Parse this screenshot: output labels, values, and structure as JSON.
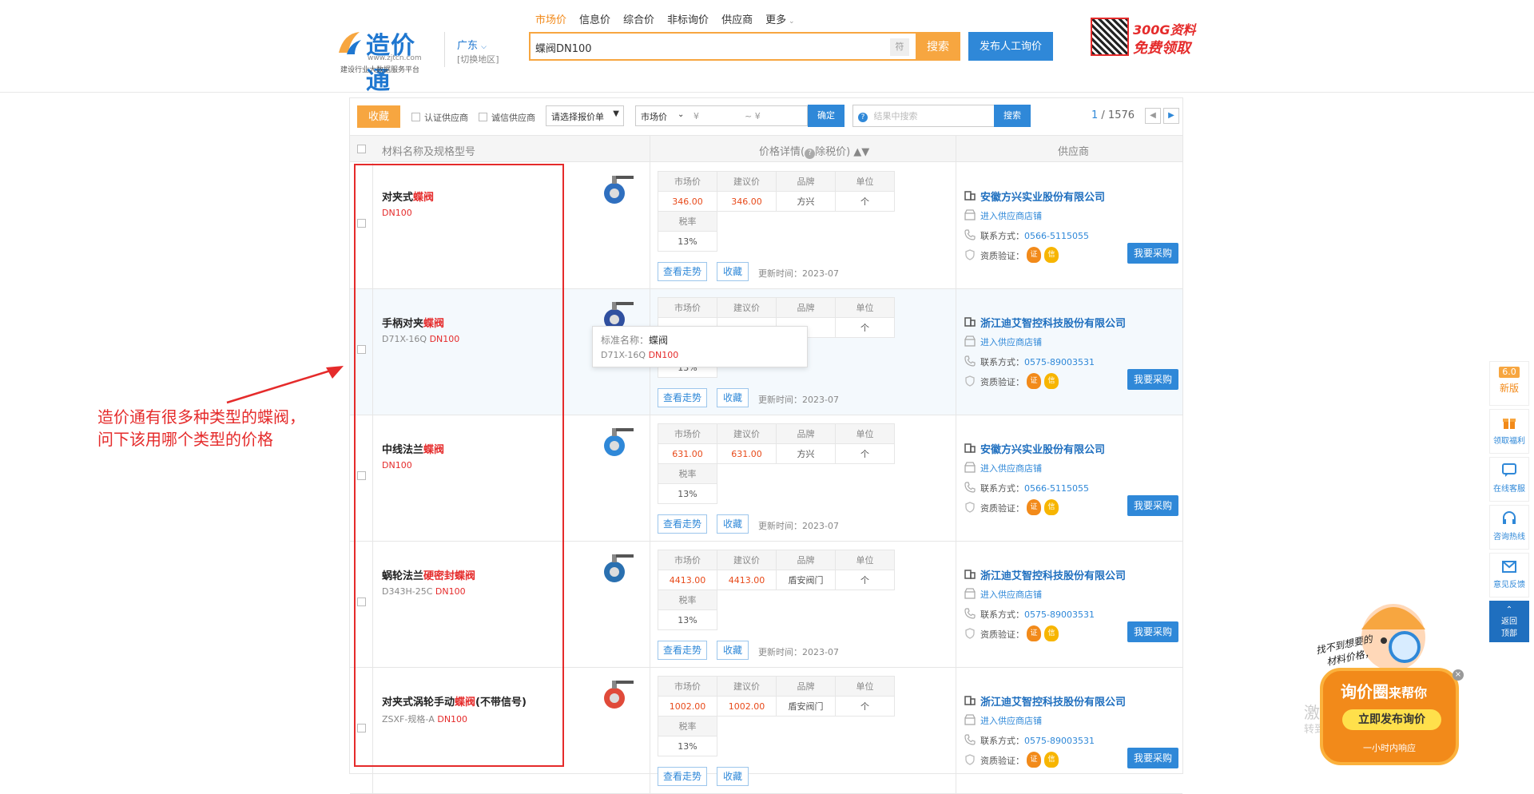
{
  "header": {
    "logo_text": "造价通",
    "logo_url": "www.zjtcn.com",
    "logo_slogan": "建设行业大数据服务平台",
    "region": "广东",
    "region_switch": "[切换地区]",
    "nav": [
      "市场价",
      "信息价",
      "综合价",
      "非标询价",
      "供应商",
      "更多"
    ],
    "search_value": "蝶阀DN100",
    "fu_label": "符",
    "search_label": "搜索",
    "post_label": "发布人工询价",
    "promo_line1": "300G资料",
    "promo_line2": "免费领取"
  },
  "toolbar": {
    "fav_label": "收藏",
    "certified_label": "认证供应商",
    "trusted_label": "诚信供应商",
    "quote_select": "请选择报价单",
    "price_type": "市场价",
    "price_from": "¥",
    "price_to": "~ ¥",
    "ok_label": "确定",
    "inner_search_placeholder": "结果中搜索",
    "inner_search_label": "搜索",
    "page_current": "1",
    "page_total": "/ 1576"
  },
  "table_head": {
    "col1": "材料名称及规格型号",
    "col2": "价格详情(",
    "col2_b": "除税价)",
    "col3": "供应商"
  },
  "price_headers": {
    "market": "市场价",
    "suggest": "建议价",
    "brand": "品牌",
    "unit": "单位",
    "tax": "税率"
  },
  "row_buttons": {
    "trend": "查看走势",
    "fav": "收藏",
    "updated_prefix": "更新时间：",
    "enter_shop": "进入供应商店铺",
    "contact_prefix": "联系方式：",
    "qualification": "资质验证：",
    "buy": "我要采购"
  },
  "rows": [
    {
      "name_pre": "对夹式",
      "name_hl": "蝶阀",
      "name_post": "",
      "spec_pre": "",
      "spec_hl": "DN100",
      "market": "346.00",
      "suggest": "346.00",
      "brand": "方兴",
      "unit": "个",
      "tax": "13%",
      "updated": "2023-07",
      "supplier": "安徽方兴实业股份有限公司",
      "phone": "0566-5115055"
    },
    {
      "name_pre": "手柄对夹",
      "name_hl": "蝶阀",
      "name_post": "",
      "spec_pre": "D71X-16Q ",
      "spec_hl": "DN100",
      "market": "",
      "suggest": "",
      "brand": "",
      "unit": "个",
      "tax": "13%",
      "updated": "2023-07",
      "supplier": "浙江迪艾智控科技股份有限公司",
      "phone": "0575-89003531"
    },
    {
      "name_pre": "中线法兰",
      "name_hl": "蝶阀",
      "name_post": "",
      "spec_pre": "",
      "spec_hl": "DN100",
      "market": "631.00",
      "suggest": "631.00",
      "brand": "方兴",
      "unit": "个",
      "tax": "13%",
      "updated": "2023-07",
      "supplier": "安徽方兴实业股份有限公司",
      "phone": "0566-5115055"
    },
    {
      "name_pre": "蜗轮法兰",
      "name_hl": "硬密封蝶阀",
      "name_post": "",
      "spec_pre": "D343H-25C ",
      "spec_hl": "DN100",
      "market": "4413.00",
      "suggest": "4413.00",
      "brand": "盾安阀门",
      "unit": "个",
      "tax": "13%",
      "updated": "2023-07",
      "supplier": "浙江迪艾智控科技股份有限公司",
      "phone": "0575-89003531"
    },
    {
      "name_pre": "对夹式涡轮手动",
      "name_hl": "蝶阀",
      "name_post": "(不带信号)",
      "spec_pre": "ZSXF-规格-A ",
      "spec_hl": "DN100",
      "market": "1002.00",
      "suggest": "1002.00",
      "brand": "盾安阀门",
      "unit": "个",
      "tax": "13%",
      "updated": "",
      "supplier": "浙江迪艾智控科技股份有限公司",
      "phone": "0575-89003531"
    }
  ],
  "tooltip": {
    "label": "标准名称：",
    "value": "蝶阀",
    "spec_pre": "D71X-16Q ",
    "spec_hl": "DN100"
  },
  "annotation": {
    "line1": "造价通有很多种类型的蝶阀，",
    "line2": "问下该用哪个类型的价格"
  },
  "right_bar": {
    "new_version_num": "6.0",
    "new_version": "新版",
    "welfare": "领取福利",
    "online_service": "在线客服",
    "hotline": "咨询热线",
    "feedback": "意见反馈",
    "back_top1": "返回",
    "back_top2": "顶部"
  },
  "promo": {
    "hand1": "找不到想要的",
    "hand2": "材料价格，",
    "title_a": "询价圈",
    "title_b": "来帮你",
    "cta": "立即发布询价",
    "sub": "一小时内响应",
    "close": "×"
  },
  "watermark": {
    "line1": "激活",
    "line2": "转到"
  },
  "colors": {
    "accent_orange": "#f7a640",
    "accent_blue": "#2f88d8",
    "highlight_red": "#e52b2b"
  }
}
